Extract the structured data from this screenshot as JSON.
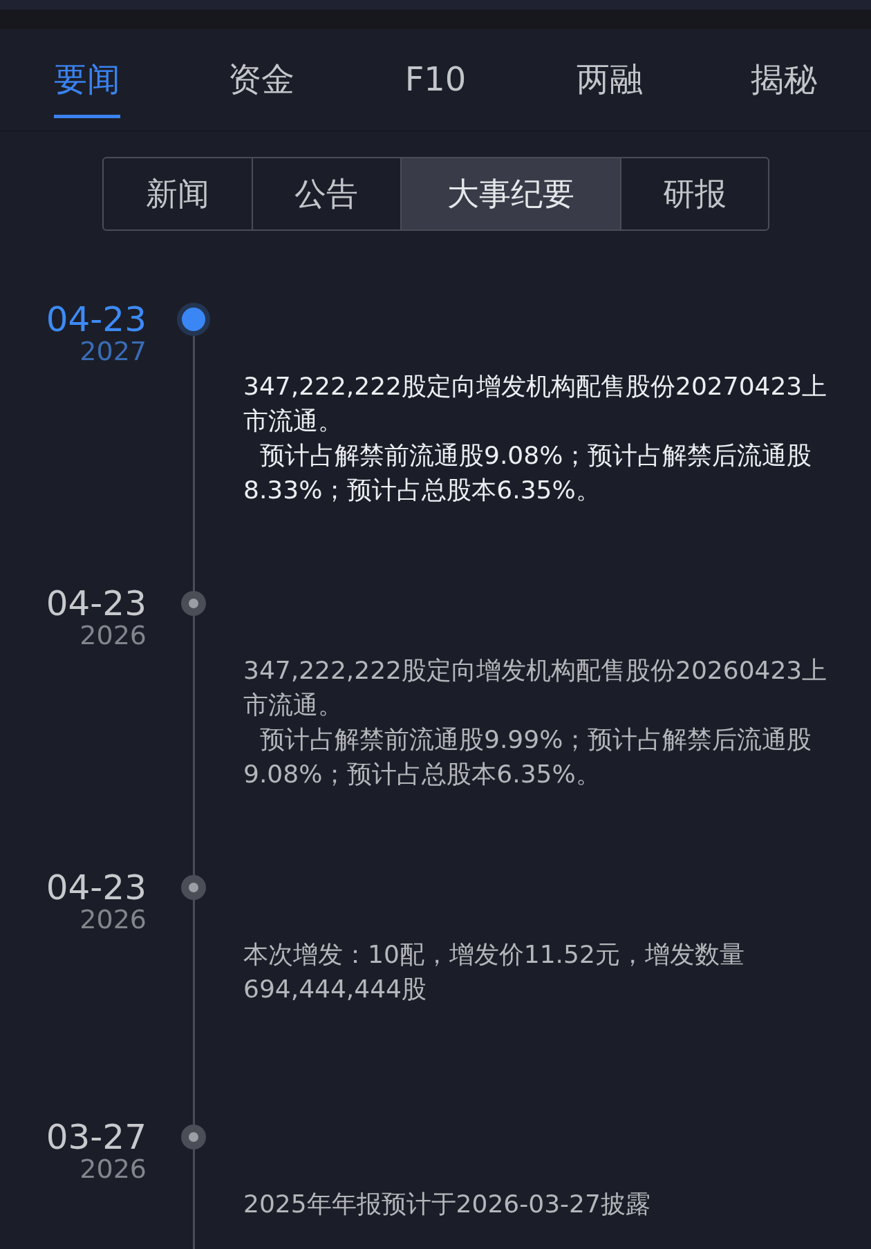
{
  "tabs": [
    {
      "label": "要闻",
      "selected": true
    },
    {
      "label": "资金",
      "selected": false
    },
    {
      "label": "F10",
      "selected": false
    },
    {
      "label": "两融",
      "selected": false
    },
    {
      "label": "揭秘",
      "selected": false
    }
  ],
  "segments": [
    {
      "label": "新闻",
      "selected": false
    },
    {
      "label": "公告",
      "selected": false
    },
    {
      "label": "大事纪要",
      "selected": true
    },
    {
      "label": "研报",
      "selected": false
    }
  ],
  "timeline": [
    {
      "date": "04-23",
      "year": "2027",
      "active": true,
      "paragraphs": [
        "347,222,222股定向增发机构配售股份20270423上市流通。",
        "预计占解禁前流通股9.08%；预计占解禁后流通股8.33%；预计占总股本6.35%。"
      ]
    },
    {
      "date": "04-23",
      "year": "2026",
      "active": false,
      "paragraphs": [
        "347,222,222股定向增发机构配售股份20260423上市流通。",
        "预计占解禁前流通股9.99%；预计占解禁后流通股9.08%；预计占总股本6.35%。"
      ]
    },
    {
      "date": "04-23",
      "year": "2026",
      "active": false,
      "paragraphs": [
        "本次增发：10配，增发价11.52元，增发数量694,444,444股"
      ]
    },
    {
      "date": "03-27",
      "year": "2026",
      "active": false,
      "paragraphs": [
        "2025年年报预计于2026-03-27披露"
      ]
    }
  ]
}
